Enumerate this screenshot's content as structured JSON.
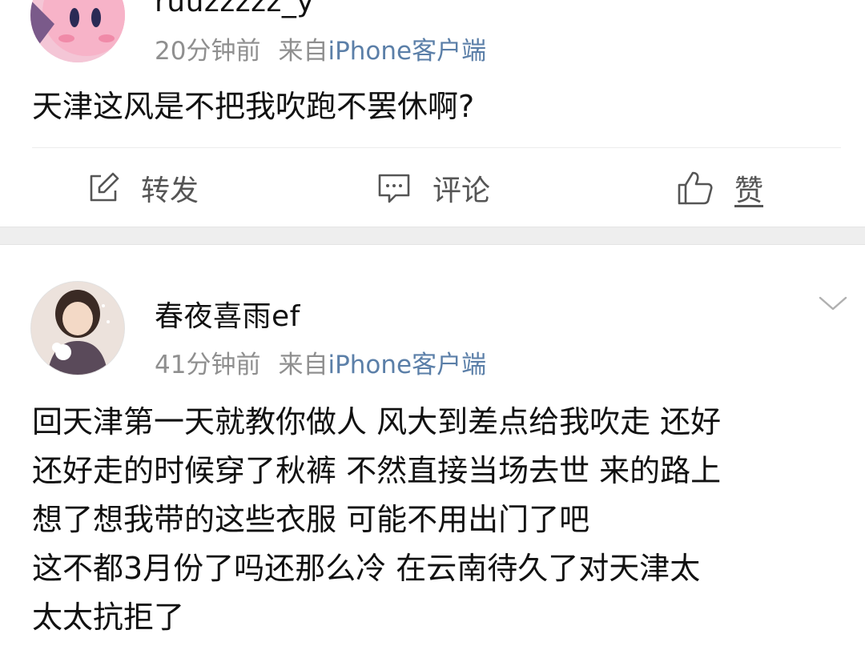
{
  "posts": [
    {
      "username": "ruuzzzzz_y",
      "time": "20分钟前",
      "source_prefix": "来自",
      "source_device": "iPhone客户端",
      "content_lines": [
        "天津这风是不把我吹跑不罢休啊?"
      ],
      "actions": {
        "repost_label": "转发",
        "comment_label": "评论",
        "like_label": "赞"
      }
    },
    {
      "username": "春夜喜雨ef",
      "time": "41分钟前",
      "source_prefix": "来自",
      "source_device": "iPhone客户端",
      "content_lines": [
        "回天津第一天就教你做人 风大到差点给我吹走 还好",
        "还好走的时候穿了秋裤 不然直接当场去世 来的路上",
        "想了想我带的这些衣服 可能不用出门了吧",
        "这不都3月份了吗还那么冷 在云南待久了对天津太",
        "太太抗拒了"
      ]
    }
  ],
  "colors": {
    "meta_gray": "#8f8f8f",
    "device_link": "#5b7fa8",
    "separator": "#eeeeee"
  },
  "icons": {
    "repost": "edit-square-icon",
    "comment": "comment-bubble-icon",
    "like": "thumbs-up-icon",
    "more": "chevron-down-icon"
  }
}
